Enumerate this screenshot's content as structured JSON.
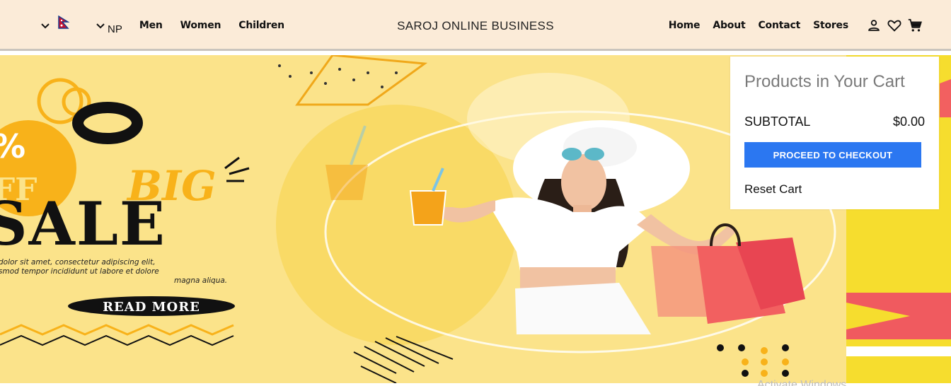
{
  "nav": {
    "np_label": "NP",
    "category_links": [
      "Men",
      "Women",
      "Children"
    ],
    "brand": "SAROJ ONLINE BUSINESS",
    "right_links": [
      "Home",
      "About",
      "Contact",
      "Stores"
    ],
    "icons": [
      "account-icon",
      "heart-icon",
      "cart-icon"
    ]
  },
  "hero": {
    "badge": "%\nFF",
    "big": "BIG",
    "sale": "SALE",
    "body_line1": "dolor sit amet, consectetur adipiscing elit,",
    "body_line2": "smod tempor incididunt ut labore et dolore",
    "body_line3": "magna aliqua.",
    "read_more": "READ MORE"
  },
  "cart": {
    "title": "Products in Your Cart",
    "subtotal_label": "SUBTOTAL",
    "subtotal_value": "$0.00",
    "checkout_label": "PROCEED TO CHECKOUT",
    "reset_label": "Reset Cart"
  },
  "watermark": "Activate Windows",
  "colors": {
    "navbar_bg": "#fbebd8",
    "hero_bg": "#fbe38a",
    "accent_yellow": "#f8b21a",
    "checkout_blue": "#2b77f1",
    "bag_red": "#f26060"
  }
}
